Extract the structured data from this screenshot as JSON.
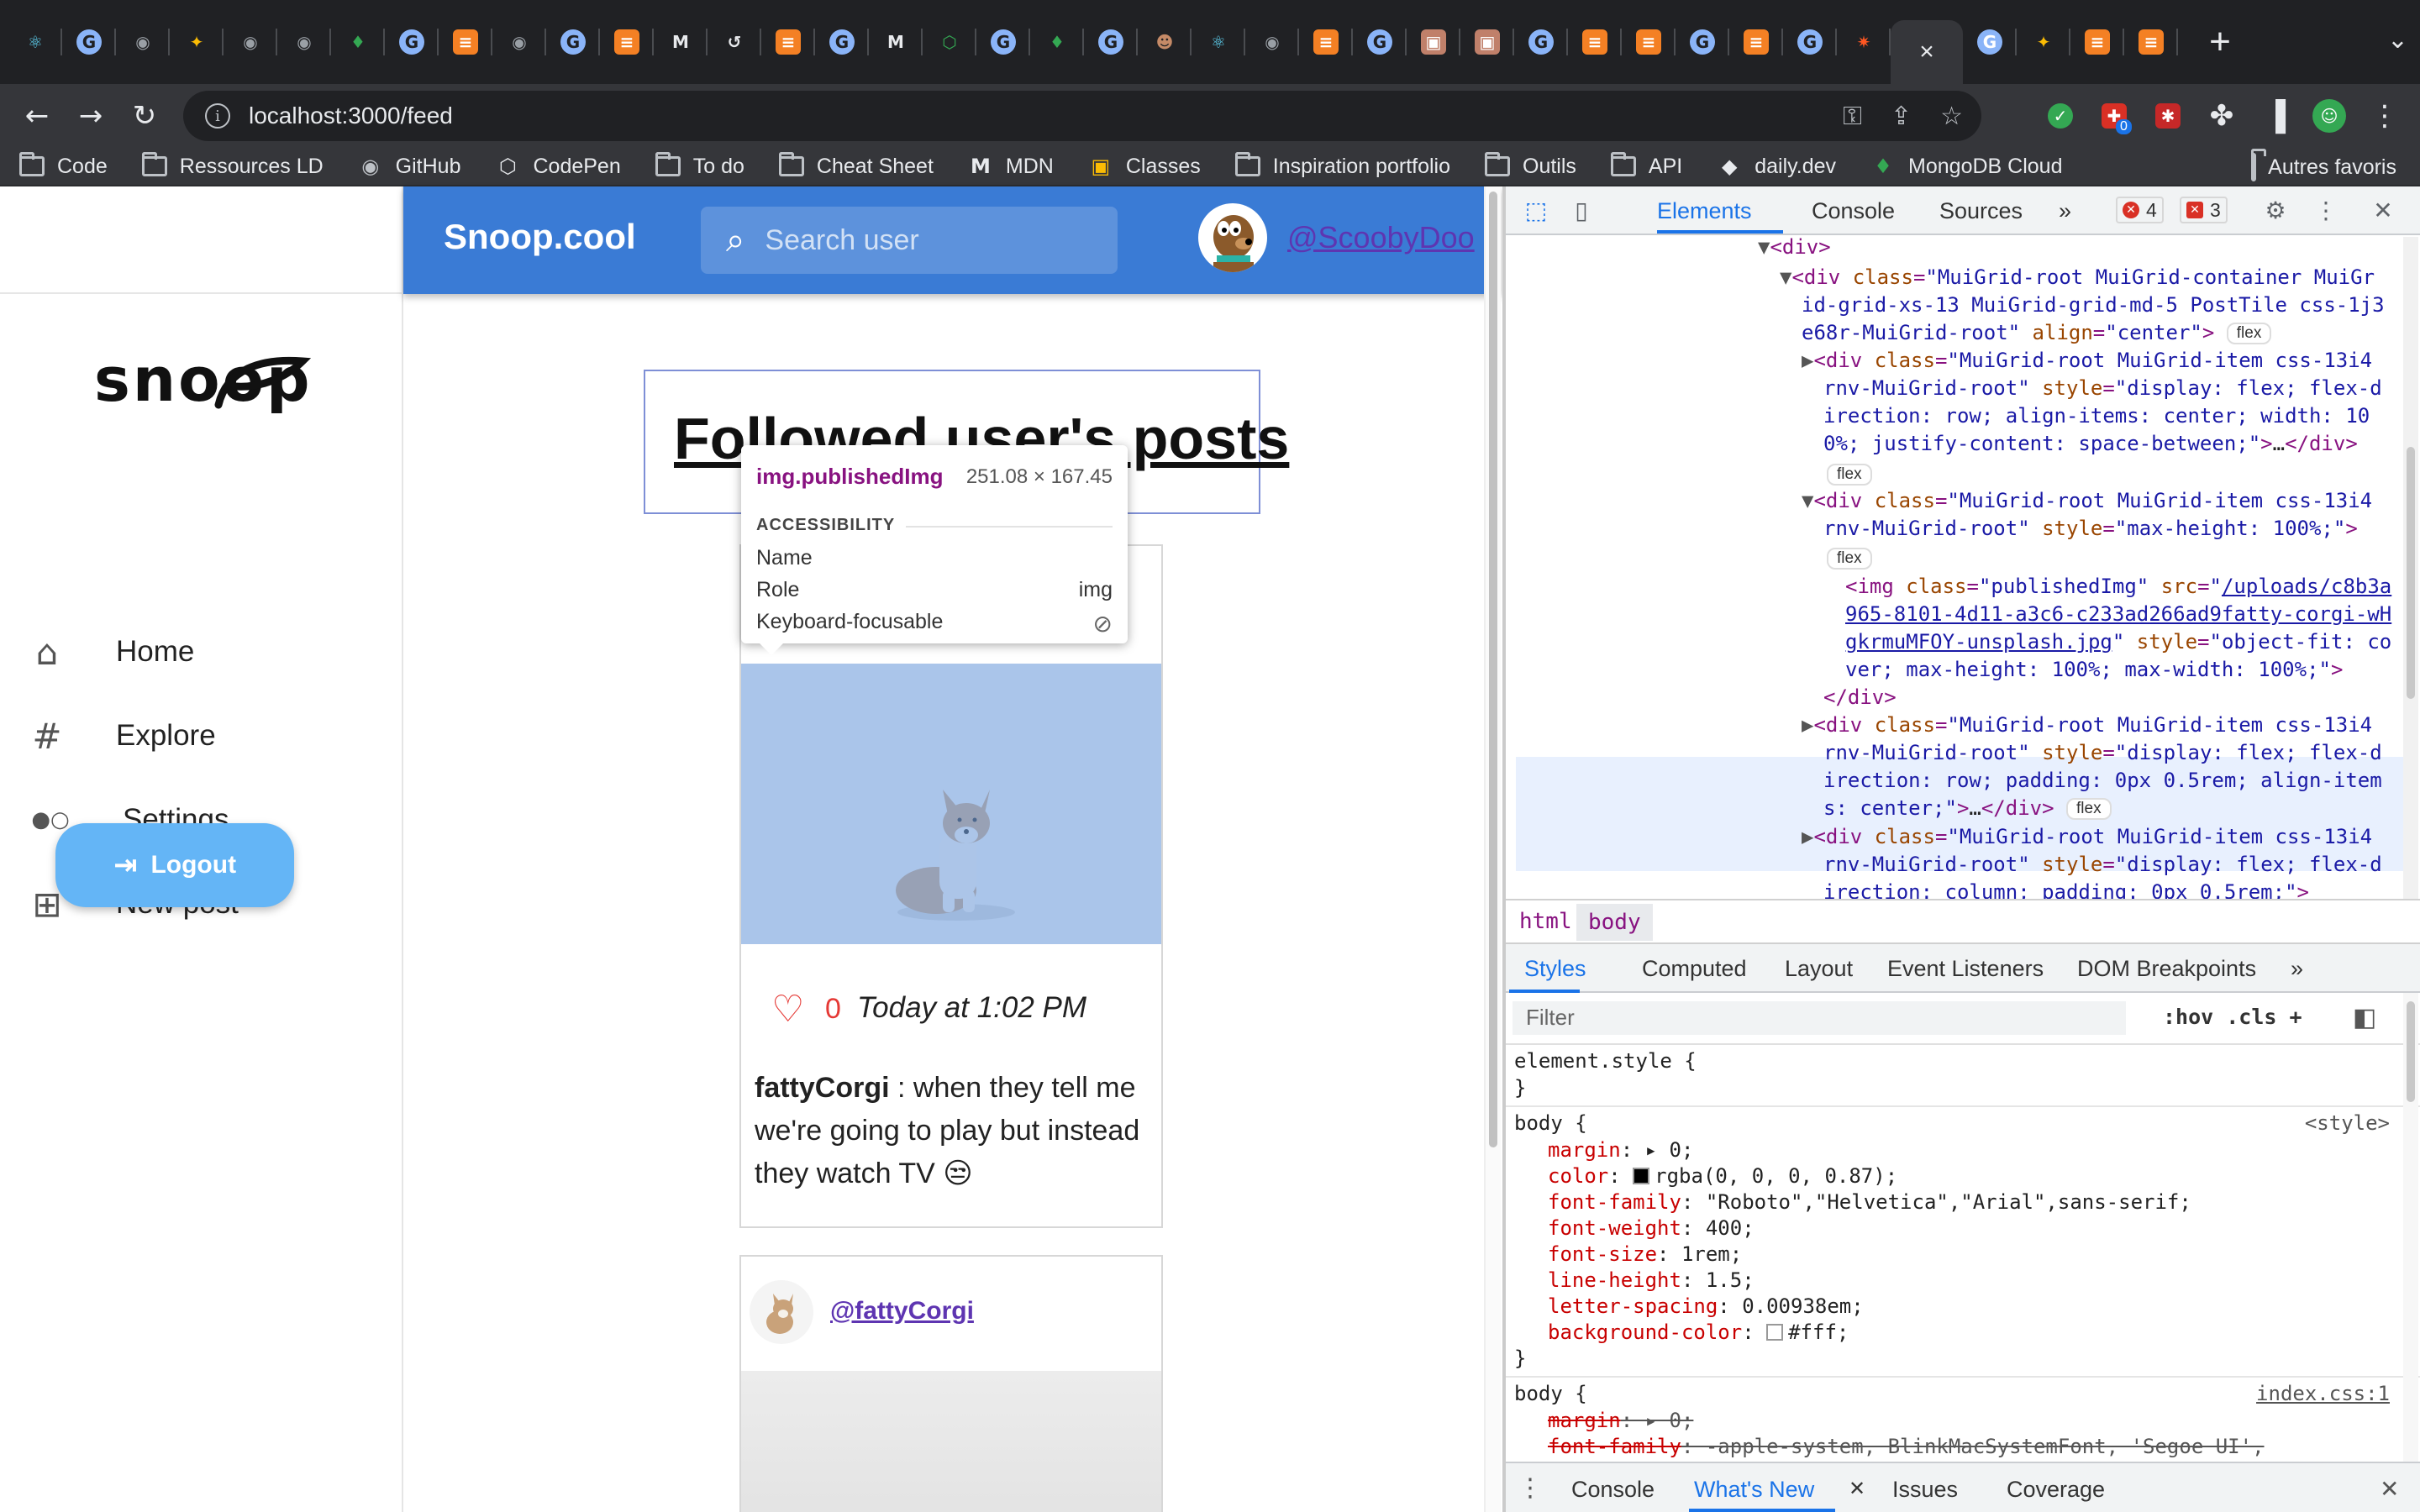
{
  "browser": {
    "tab_icons": [
      "react-icon",
      "chrome-icon",
      "github-icon",
      "star-icon",
      "github-icon",
      "github-icon",
      "mongodb-icon",
      "chrome-icon",
      "stackoverflow-icon",
      "github-icon",
      "chrome-icon",
      "stackoverflow-icon",
      "mdn-icon",
      "history-icon",
      "stackoverflow-icon",
      "chrome-icon",
      "mdn-icon",
      "codepen-icon",
      "chrome-icon",
      "mongodb-icon",
      "chrome-icon",
      "avatar-icon",
      "react-icon",
      "github-icon",
      "stackoverflow-icon",
      "chrome-icon",
      "classroom-icon",
      "classroom-icon",
      "chrome-icon",
      "stackoverflow-icon",
      "stackoverflow-icon",
      "chrome-icon",
      "stackoverflow-icon",
      "chrome-icon",
      "gear-icon"
    ],
    "tab_colors": [
      "#61dafb",
      "#8ab4f8",
      "#9aa0a6",
      "#fbbc04",
      "#9aa0a6",
      "#9aa0a6",
      "#34a853",
      "#8ab4f8",
      "#f48024",
      "#9aa0a6",
      "#8ab4f8",
      "#f48024",
      "#e8eaed",
      "#e8eaed",
      "#f48024",
      "#8ab4f8",
      "#e8eaed",
      "#34a853",
      "#8ab4f8",
      "#34a853",
      "#8ab4f8",
      "#c58a67",
      "#61dafb",
      "#9aa0a6",
      "#f48024",
      "#8ab4f8",
      "#c0806a",
      "#c0806a",
      "#8ab4f8",
      "#f48024",
      "#f48024",
      "#8ab4f8",
      "#f48024",
      "#8ab4f8",
      "#ff5722"
    ],
    "tab_close": "×",
    "new_tab": "+",
    "url": "localhost:3000/feed",
    "bookmarks": [
      {
        "label": "Code",
        "icon": "folder-icon"
      },
      {
        "label": "Ressources LD",
        "icon": "folder-icon"
      },
      {
        "label": "GitHub",
        "icon": "github-icon"
      },
      {
        "label": "CodePen",
        "icon": "codepen-icon"
      },
      {
        "label": "To do",
        "icon": "folder-icon"
      },
      {
        "label": "Cheat Sheet",
        "icon": "folder-icon"
      },
      {
        "label": "MDN",
        "icon": "mdn-icon"
      },
      {
        "label": "Classes",
        "icon": "classroom-icon"
      },
      {
        "label": "Inspiration portfolio",
        "icon": "folder-icon"
      },
      {
        "label": "Outils",
        "icon": "folder-icon"
      },
      {
        "label": "API",
        "icon": "folder-icon"
      },
      {
        "label": "daily.dev",
        "icon": "dailydev-icon"
      },
      {
        "label": "MongoDB Cloud",
        "icon": "mongodb-icon"
      }
    ],
    "other_bookmarks": "Autres favoris",
    "extension_badge": "0"
  },
  "app": {
    "logo": "snoop",
    "brand": "Snoop.cool",
    "search_placeholder": "Search user",
    "current_user": "@ScoobyDoo",
    "nav": [
      {
        "label": "Home",
        "icon": "home-icon",
        "glyph": "⌂"
      },
      {
        "label": "Explore",
        "icon": "hashtag-icon",
        "glyph": "#"
      },
      {
        "label": "Settings",
        "icon": "toggle-icon",
        "glyph": "●○"
      },
      {
        "label": "New post",
        "icon": "add-box-icon",
        "glyph": "⊞"
      }
    ],
    "logout": "Logout",
    "feed_title": "Followed user's posts",
    "posts": [
      {
        "likes": "0",
        "time": "Today at 1:02 PM",
        "author": "fattyCorgi",
        "text": " : when they tell me we're going to play but instead they watch TV 😒"
      },
      {
        "author_handle": "@fattyCorgi"
      }
    ]
  },
  "inspect_tooltip": {
    "element": "img.publishedImg",
    "size": "251.08 × 167.45",
    "section": "ACCESSIBILITY",
    "rows": [
      {
        "k": "Name",
        "v": ""
      },
      {
        "k": "Role",
        "v": "img"
      },
      {
        "k": "Keyboard-focusable",
        "v": "⃠"
      }
    ]
  },
  "devtools": {
    "tabs": [
      "Elements",
      "Console",
      "Sources",
      "»"
    ],
    "errors": "4",
    "issues": "3",
    "breadcrumbs": [
      "html",
      "body"
    ],
    "subtabs": [
      "Styles",
      "Computed",
      "Layout",
      "Event Listeners",
      "DOM Breakpoints",
      "»"
    ],
    "filter_placeholder": "Filter",
    "filter_tools": ":hov  .cls   +",
    "drawer_tabs": [
      "Console",
      "What's New",
      "Issues",
      "Coverage"
    ]
  }
}
